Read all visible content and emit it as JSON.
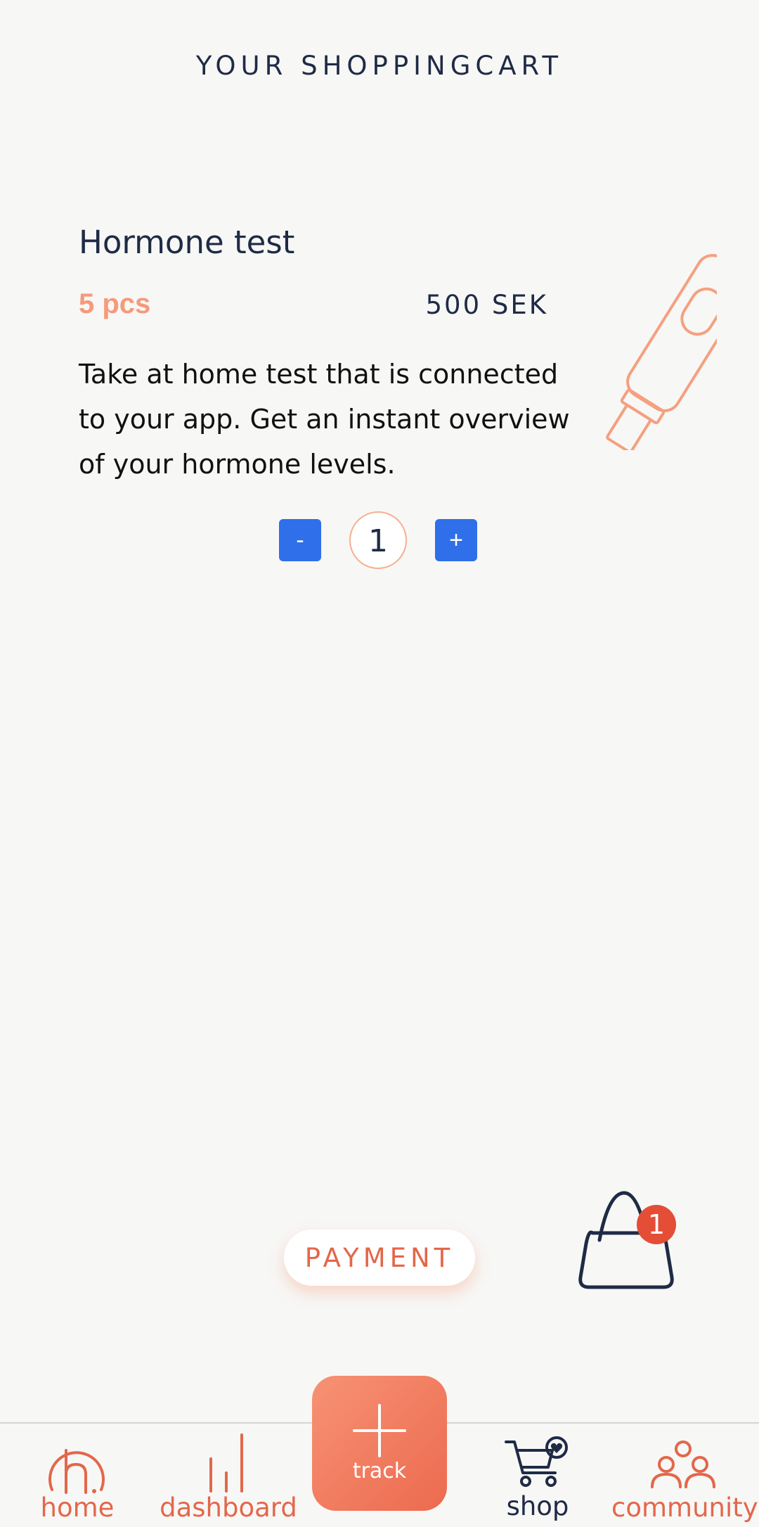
{
  "header": {
    "title": "YOUR SHOPPINGCART"
  },
  "product": {
    "name": "Hormone test",
    "quantity_label": "5 pcs",
    "price": "500 SEK",
    "description": "Take at home test that is connected to your app. Get an instant overview of your hormone levels."
  },
  "stepper": {
    "minus_label": "-",
    "quantity": "1",
    "plus_label": "+"
  },
  "payment": {
    "label": "PAYMENT"
  },
  "cart": {
    "badge_count": "1"
  },
  "nav": {
    "home": "home",
    "dashboard": "dashboard",
    "track": "track",
    "shop": "shop",
    "community": "community"
  },
  "colors": {
    "accent": "#e3674a",
    "peach": "#f59a7a",
    "navy": "#1f2b45",
    "blue": "#2f6fea",
    "background": "#f7f7f6"
  }
}
